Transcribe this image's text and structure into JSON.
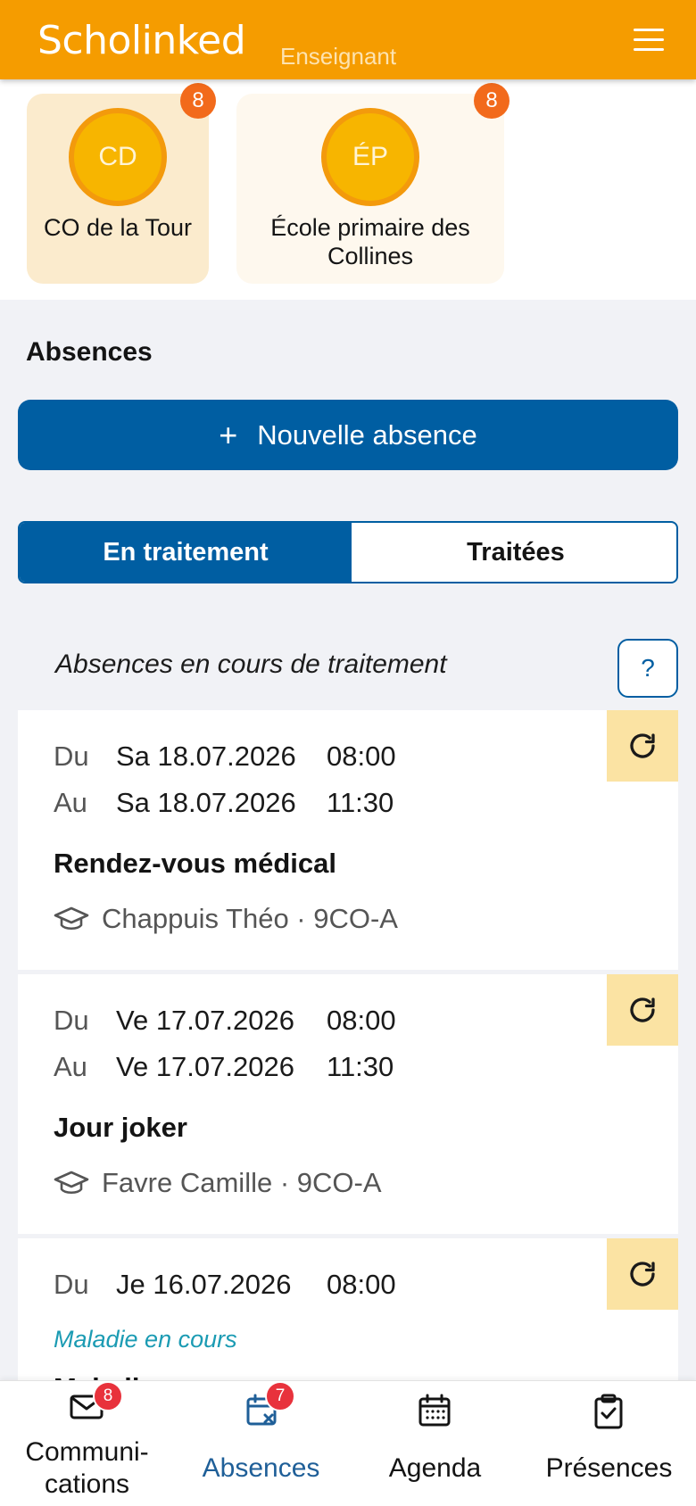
{
  "header": {
    "logo_text": "Scholinked",
    "role_label": "Enseignant",
    "menu_icon": "hamburger-menu-icon",
    "background_color": "#f59c00"
  },
  "schools": [
    {
      "initials": "CD",
      "name": "CO de la Tour",
      "badge": "8",
      "selected": true
    },
    {
      "initials": "ÉP",
      "name": "École primaire des Collines",
      "badge": "8",
      "selected": false
    }
  ],
  "absences_section": {
    "title": "Absences",
    "new_button_icon": "+",
    "new_button_label": "Nouvelle absence",
    "tabs": [
      {
        "label": "En traitement",
        "active": true
      },
      {
        "label": "Traitées",
        "active": false
      }
    ],
    "subtitle": "Absences en cours de traitement",
    "help_label": "?"
  },
  "absences": [
    {
      "from_label": "Du",
      "from_date": "Sa 18.07.2026",
      "from_time": "08:00",
      "to_label": "Au",
      "to_date": "Sa 18.07.2026",
      "to_time": "11:30",
      "reason": "Rendez-vous médical",
      "student": "Chappuis Théo · 9CO-A"
    },
    {
      "from_label": "Du",
      "from_date": "Ve 17.07.2026",
      "from_time": "08:00",
      "to_label": "Au",
      "to_date": "Ve 17.07.2026",
      "to_time": "11:30",
      "reason": "Jour joker",
      "student": "Favre Camille · 9CO-A"
    },
    {
      "from_label": "Du",
      "from_date": "Je 16.07.2026",
      "from_time": "08:00",
      "status": "Maladie en cours",
      "reason": "Maladie"
    }
  ],
  "bottom_nav": [
    {
      "label_line1": "Communi-",
      "label_line2": "cations",
      "icon": "envelope-icon",
      "badge": "8",
      "active": false
    },
    {
      "label": "Absences",
      "icon": "calendar-x-icon",
      "badge": "7",
      "active": true
    },
    {
      "label": "Agenda",
      "icon": "calendar-grid-icon",
      "active": false
    },
    {
      "label": "Présences",
      "icon": "clipboard-check-icon",
      "active": false
    }
  ],
  "colors": {
    "primary_blue": "#005ea2",
    "orange_badge": "#f26a1b",
    "red_badge": "#e8323c",
    "refresh_bg": "#fbe3a3",
    "status_teal": "#1b9bb3"
  }
}
